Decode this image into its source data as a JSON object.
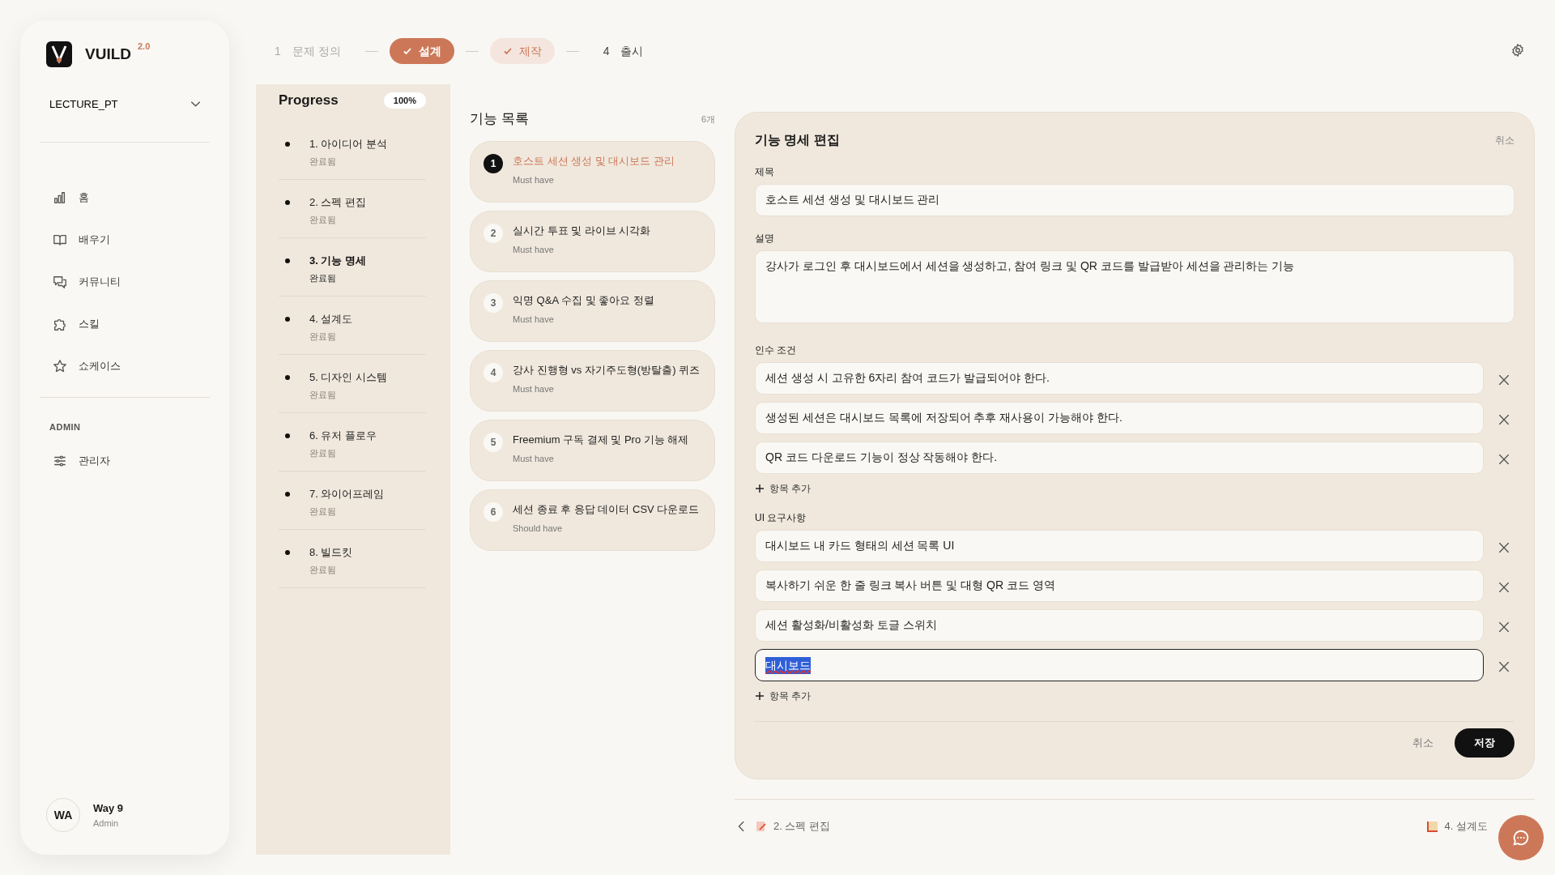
{
  "stepper": [
    {
      "number": "1",
      "label": "문제 정의",
      "kind": "past"
    },
    {
      "label": "설계",
      "kind": "current"
    },
    {
      "label": "제작",
      "kind": "completed"
    },
    {
      "number": "4",
      "label": "출시",
      "kind": "upcoming"
    }
  ],
  "sidebar": {
    "brand": "VUILD",
    "version": "2.0",
    "project": "LECTURE_PT",
    "nav": [
      {
        "label": "홈"
      },
      {
        "label": "배우기"
      },
      {
        "label": "커뮤니티"
      },
      {
        "label": "스킬"
      },
      {
        "label": "쇼케이스"
      }
    ],
    "admin_heading": "ADMIN",
    "admin_nav": [
      {
        "label": "관리자"
      }
    ],
    "user": {
      "initials": "WA",
      "name": "Way 9",
      "role": "Admin"
    }
  },
  "progress": {
    "title": "Progress",
    "percent": "100%",
    "steps": [
      {
        "title": "1. 아이디어 분석",
        "status": "완료됨",
        "selected": false
      },
      {
        "title": "2. 스펙 편집",
        "status": "완료됨",
        "selected": false
      },
      {
        "title": "3. 기능 명세",
        "status": "완료됨",
        "selected": true
      },
      {
        "title": "4. 설계도",
        "status": "완료됨",
        "selected": false
      },
      {
        "title": "5. 디자인 시스템",
        "status": "완료됨",
        "selected": false
      },
      {
        "title": "6. 유저 플로우",
        "status": "완료됨",
        "selected": false
      },
      {
        "title": "7. 와이어프레임",
        "status": "완료됨",
        "selected": false
      },
      {
        "title": "8. 빌드킷",
        "status": "완료됨",
        "selected": false
      }
    ]
  },
  "features": {
    "title": "기능 목록",
    "count": "6개",
    "items": [
      {
        "number": "1",
        "title": "호스트 세션 생성 및 대시보드 관리",
        "priority": "Must have",
        "selected": true
      },
      {
        "number": "2",
        "title": "실시간 투표 및 라이브 시각화",
        "priority": "Must have",
        "selected": false
      },
      {
        "number": "3",
        "title": "익명 Q&A 수집 및 좋아요 정렬",
        "priority": "Must have",
        "selected": false
      },
      {
        "number": "4",
        "title": "강사 진행형 vs 자기주도형(방탈출) 퀴즈",
        "priority": "Must have",
        "selected": false
      },
      {
        "number": "5",
        "title": "Freemium 구독 결제 및 Pro 기능 해제",
        "priority": "Must have",
        "selected": false
      },
      {
        "number": "6",
        "title": "세션 종료 후 응답 데이터 CSV 다운로드",
        "priority": "Should have",
        "selected": false
      }
    ]
  },
  "editor": {
    "title": "기능 명세 편집",
    "cancel_link": "취소",
    "title_label": "제목",
    "title_value": "호스트 세션 생성 및 대시보드 관리",
    "description_label": "설명",
    "description_value": "강사가 로그인 후 대시보드에서 세션을 생성하고, 참여 링크 및 QR 코드를 발급받아 세션을 관리하는 기능",
    "lists": [
      {
        "label": "인수 조건",
        "add": "항목 추가",
        "items": [
          {
            "value": "세션 생성 시 고유한 6자리 참여 코드가 발급되어야 한다.",
            "focused": false
          },
          {
            "value": "생성된 세션은 대시보드 목록에 저장되어 추후 재사용이 가능해야 한다.",
            "focused": false
          },
          {
            "value": "QR 코드 다운로드 기능이 정상 작동해야 한다.",
            "focused": false
          }
        ]
      },
      {
        "label": "UI 요구사항",
        "add": "항목 추가",
        "items": [
          {
            "value": "대시보드 내 카드 형태의 세션 목록 UI",
            "focused": false
          },
          {
            "value": "복사하기 쉬운 한 줄 링크 복사 버튼 및 대형 QR 코드 영역",
            "focused": false
          },
          {
            "value": "세션 활성화/비활성화 토글 스위치",
            "focused": false
          },
          {
            "value": "대시보드",
            "focused": true
          }
        ]
      }
    ],
    "cancel_button": "취소",
    "save_button": "저장"
  },
  "pager": {
    "previous": "2. 스펙 편집",
    "next": "4. 설계도"
  }
}
